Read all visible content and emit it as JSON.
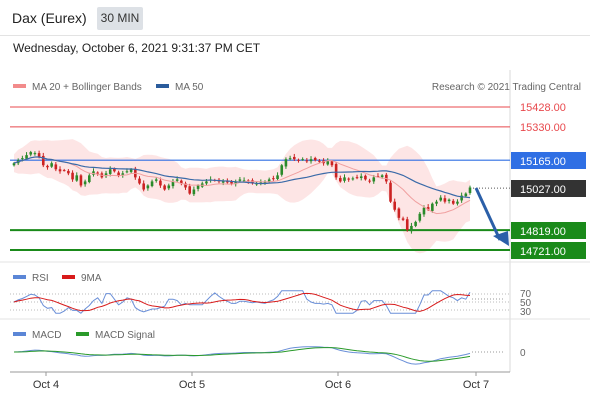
{
  "header": {
    "instrument": "Dax (Eurex)",
    "interval": "30 MIN",
    "datetime": "Wednesday, October 6, 2021 9:31:37 PM CET"
  },
  "colors": {
    "resistance": "#e8494d",
    "pivot": "#2f6fe4",
    "support": "#1a8a1a",
    "last": "#333333",
    "up_candle": "#2a8a2a",
    "down_candle": "#cc2222",
    "band_fill": "#fde0e0",
    "ma20": "#f0a0a0",
    "ma50": "#3a6aa8",
    "rsi": "#6a8fd8",
    "rsi_ma": "#d81b1b",
    "macd": "#6a8fd8",
    "macd_signal": "#2a9a2a",
    "arrow": "#2b5fa8"
  },
  "chart_data": [
    {
      "type": "candlestick",
      "legend": [
        "MA 20 + Bollinger Bands",
        "MA 50"
      ],
      "copyright": "Research © 2021 Trading Central",
      "x_labels": [
        "Oct 4",
        "Oct 5",
        "Oct 6",
        "Oct 7"
      ],
      "levels": [
        {
          "label": "15428.00",
          "value": 15428,
          "kind": "resistance"
        },
        {
          "label": "15330.00",
          "value": 15330,
          "kind": "resistance"
        },
        {
          "label": "15165.00",
          "value": 15165,
          "kind": "pivot"
        },
        {
          "label": "15027.00",
          "value": 15027,
          "kind": "last"
        },
        {
          "label": "14819.00",
          "value": 14819,
          "kind": "support"
        },
        {
          "label": "14721.00",
          "value": 14721,
          "kind": "support"
        }
      ],
      "close": [
        15150,
        15165,
        15175,
        15190,
        15205,
        15200,
        15180,
        15140,
        15130,
        15150,
        15120,
        15110,
        15115,
        15100,
        15070,
        15090,
        15040,
        15060,
        15090,
        15110,
        15100,
        15080,
        15100,
        15120,
        15110,
        15090,
        15100,
        15110,
        15120,
        15080,
        15050,
        15020,
        15040,
        15060,
        15070,
        15040,
        15020,
        15040,
        15060,
        15070,
        15050,
        15030,
        15000,
        15020,
        15040,
        15050,
        15060,
        15070,
        15065,
        15060,
        15060,
        15055,
        15050,
        15060,
        15070,
        15065,
        15060,
        15050,
        15050,
        15055,
        15060,
        15070,
        15075,
        15090,
        15140,
        15170,
        15175,
        15170,
        15165,
        15170,
        15160,
        15170,
        15165,
        15160,
        15150,
        15160,
        15140,
        15080,
        15060,
        15080,
        15070,
        15075,
        15080,
        15085,
        15070,
        15060,
        15080,
        15085,
        15090,
        15060,
        14960,
        14920,
        14880,
        14870,
        14820,
        14840,
        14860,
        14900,
        14930,
        14920,
        14950,
        14960,
        14980,
        14960,
        14970,
        14950,
        14960,
        14990,
        15000,
        15030
      ]
    },
    {
      "type": "line",
      "legend": [
        "RSI",
        "9MA"
      ],
      "y_labels": [
        "70",
        "50",
        "30"
      ]
    },
    {
      "type": "line",
      "legend": [
        "MACD",
        "MACD Signal"
      ],
      "y_labels": [
        "0"
      ]
    }
  ]
}
